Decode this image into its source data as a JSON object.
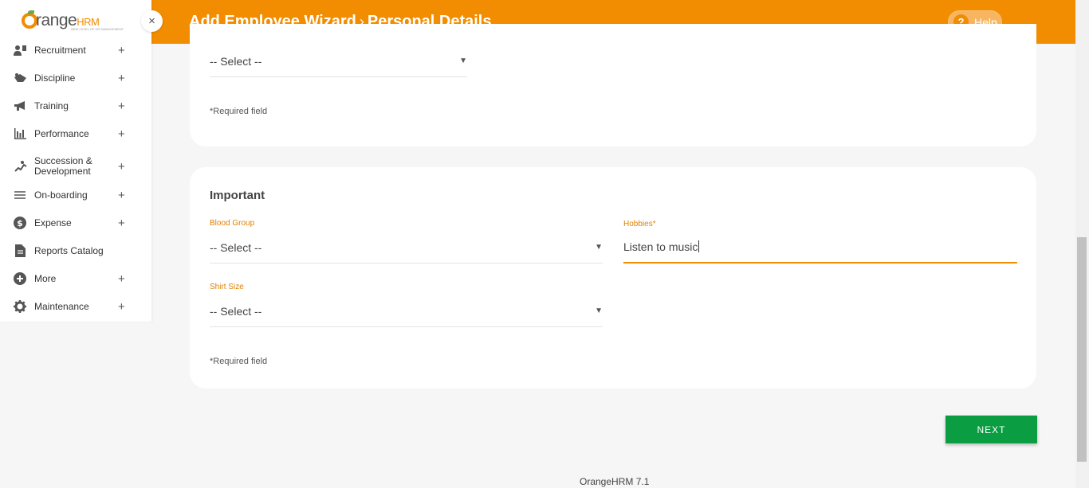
{
  "header": {
    "title_part1": "Add Employee Wizard",
    "chevron": "›",
    "title_part2": "Personal Details",
    "help_label": "Help",
    "help_icon": "?"
  },
  "sidebar": {
    "logo_text": "range",
    "logo_hrm": "HRM",
    "logo_tagline": "NEW LEVEL OF HR MANAGEMENT",
    "close_icon": "×",
    "items": [
      {
        "label": "Recruitment",
        "icon": "recruitment-icon",
        "expandable": true
      },
      {
        "label": "Discipline",
        "icon": "discipline-icon",
        "expandable": true
      },
      {
        "label": "Training",
        "icon": "megaphone-icon",
        "expandable": true
      },
      {
        "label": "Performance",
        "icon": "bar-chart-icon",
        "expandable": true
      },
      {
        "label": "Succession & Development",
        "icon": "succession-icon",
        "expandable": true
      },
      {
        "label": "On-boarding",
        "icon": "onboarding-icon",
        "expandable": true
      },
      {
        "label": "Expense",
        "icon": "dollar-icon",
        "expandable": true
      },
      {
        "label": "Reports Catalog",
        "icon": "document-icon",
        "expandable": false
      },
      {
        "label": "More",
        "icon": "plus-circle-icon",
        "expandable": true
      },
      {
        "label": "Maintenance",
        "icon": "gear-icon",
        "expandable": true
      }
    ],
    "plus": "+"
  },
  "card1": {
    "select_value": "-- Select --",
    "required_note": "*Required field"
  },
  "card2": {
    "title": "Important",
    "blood_group": {
      "label": "Blood Group",
      "value": "-- Select --"
    },
    "hobbies": {
      "label": "Hobbies*",
      "value": "Listen to music"
    },
    "shirt_size": {
      "label": "Shirt Size",
      "value": "-- Select --"
    },
    "required_note": "*Required field"
  },
  "caret": "▼",
  "next_label": "NEXT",
  "footer": "OrangeHRM 7.1",
  "colors": {
    "brand_orange": "#f28c00",
    "next_green": "#0a9d42"
  }
}
